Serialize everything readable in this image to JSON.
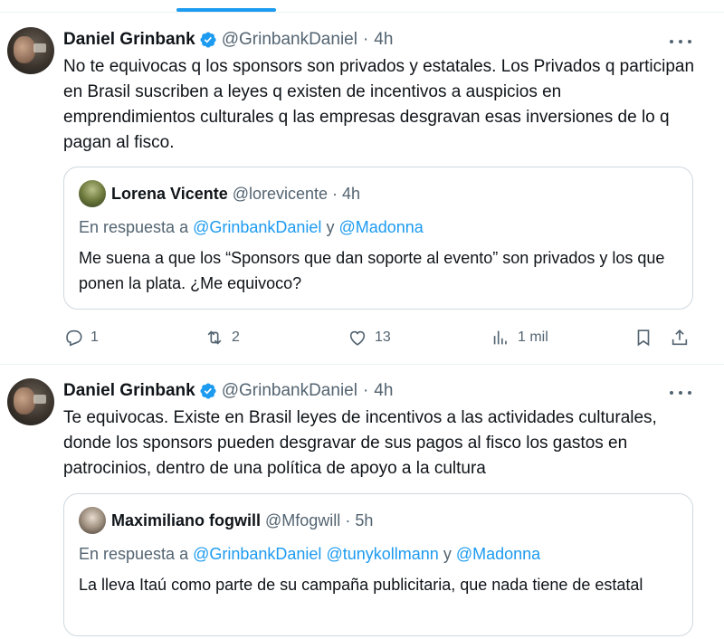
{
  "tweets": [
    {
      "author_name": "Daniel Grinbank",
      "handle": "@GrinbankDaniel",
      "separator": "·",
      "time": "4h",
      "text": "No te equivocas q los sponsors son privados y estatales.  Los Privados q participan en Brasil  suscriben a leyes q existen de incentivos a auspicios en emprendimientos culturales q las empresas desgravan esas inversiones de lo q pagan al fisco.",
      "quote": {
        "author_name": "Lorena Vicente",
        "handle": "@lorevicente",
        "separator": "·",
        "time": "4h",
        "reply_prefix": "En respuesta a",
        "mention_1": "@GrinbankDaniel",
        "conj": "y",
        "mention_2": "@Madonna",
        "text": "Me suena a que los “Sponsors que dan soporte al evento” son privados y los que ponen la plata. ¿Me equivoco?"
      },
      "actions": {
        "replies": "1",
        "reposts": "2",
        "likes": "13",
        "views": "1 mil"
      }
    },
    {
      "author_name": "Daniel Grinbank",
      "handle": "@GrinbankDaniel",
      "separator": "·",
      "time": "4h",
      "text": "Te equivocas. Existe en Brasil leyes de incentivos a las actividades culturales, donde los sponsors pueden desgravar de sus pagos al fisco los gastos en patrocinios, dentro de una política de apoyo a la cultura",
      "quote": {
        "author_name": "Maximiliano fogwill",
        "handle": "@Mfogwill",
        "separator": "·",
        "time": "5h",
        "reply_prefix": "En respuesta a",
        "mention_1": "@GrinbankDaniel",
        "mention_2": "@tunykollmann",
        "conj": "y",
        "mention_3": "@Madonna",
        "text": "La lleva Itaú como parte de su campaña publicitaria, que nada tiene de estatal"
      }
    }
  ],
  "icons": {
    "verified": "verified-badge-icon",
    "more": "more-icon",
    "reply": "reply-icon",
    "repost": "repost-icon",
    "like": "heart-icon",
    "views": "views-icon",
    "bookmark": "bookmark-icon",
    "share": "share-icon"
  },
  "colors": {
    "accent": "#1d9bf0",
    "text": "#0f1419",
    "secondary": "#536471",
    "border": "#cfd9de"
  }
}
